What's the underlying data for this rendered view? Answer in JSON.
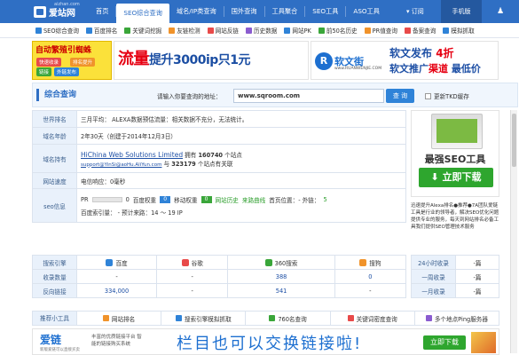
{
  "logo": {
    "text": "爱站网",
    "sub": "aizhan.com"
  },
  "nav": {
    "items": [
      "首页",
      "SEO综合查询",
      "域名/IP类查询",
      "国外查询",
      "工具聚合",
      "SEO工具",
      "ASO工具"
    ],
    "active": 1,
    "subscribe": "▾ 订阅",
    "mobile": "手机版",
    "user_icon": "user-icon"
  },
  "toolbar": {
    "items": [
      {
        "label": "SEO综合查询",
        "color": "#2f83d8"
      },
      {
        "label": "百度排名",
        "color": "#2f83d8"
      },
      {
        "label": "关键词挖掘",
        "color": "#3aa63a"
      },
      {
        "label": "友链检测",
        "color": "#f0932b"
      },
      {
        "label": "网站反链",
        "color": "#e84a4a"
      },
      {
        "label": "历史数据",
        "color": "#8a5cd0"
      },
      {
        "label": "网站PK",
        "color": "#2f83d8"
      },
      {
        "label": "前50名历史",
        "color": "#3aa63a"
      },
      {
        "label": "PR值查询",
        "color": "#f0932b"
      },
      {
        "label": "备案查询",
        "color": "#e84a4a"
      },
      {
        "label": "模拟抓取",
        "color": "#2f83d8"
      }
    ]
  },
  "ads": {
    "left": {
      "title": "自动繁殖引蜘蛛",
      "pills": [
        "快速收录",
        "排名提升",
        "链接",
        "外链发布"
      ]
    },
    "mid": {
      "big": "流量",
      "rest": "提升3000ip只1元"
    },
    "right": {
      "brand": "软文街",
      "url": "www.RUANWENJIE.COM",
      "line1_pre": "软文发布 ",
      "line1_hi": "4折",
      "line2_pre": "软文推广",
      "line2_hi": "渠道",
      "line2_post": " 最低价"
    }
  },
  "query": {
    "title": "综合查询",
    "label": "请输入你要查询的地址：",
    "value": "www.sqroom.com",
    "button": "查 询",
    "checkbox": "更新TKD缓存"
  },
  "info": {
    "rank": {
      "key": "世界排名",
      "value": "三月平均： ALEXA数据预估流量：相关数据不充分，无法统计。"
    },
    "age": {
      "key": "域名年龄",
      "value": "2年30天（创建于2014年12月3日）"
    },
    "owner": {
      "key": "域名持有",
      "name": "HiChina Web Solutions Limited",
      "mid1": " 拥有 ",
      "count1": "160740",
      "mid2": " 个站点",
      "email": "support@YinSi@aoHu.AliYun.com",
      "mid3": " 与 ",
      "count2": "323179",
      "mid4": " 个站点有关联"
    },
    "speed": {
      "key": "网站速度",
      "value": "电信响应：0毫秒"
    },
    "seo": {
      "key": "seo信息",
      "pr": "PR",
      "pr_val": "0",
      "baidu_w": "百度权重",
      "baidu_val": "0",
      "mobile_w": "移动权重",
      "mobile_val": "0",
      "history": "网站历史",
      "trend": "来路曲线",
      "home": "首页位置：- 外链：",
      "links": "5",
      "line2": "百度索引量： - 预计来路：14 ～ 19 IP"
    }
  },
  "side_ad": {
    "title": "最强SEO工具",
    "button": "立即下载",
    "desc": "迅速提升Alexa排名●推荐●7A团队爱链工具是行业的领导者，解决SEO优化问题提供专业的服务，每天到网站排名必备工具我们提供SEO管理技术服务"
  },
  "stats": {
    "headers": [
      "搜索引擎",
      "百度",
      "谷歌",
      "360搜索",
      "搜狗"
    ],
    "colors": [
      "#2f83d8",
      "#e84a4a",
      "#3aa63a",
      "#f0932b"
    ],
    "rows": [
      {
        "key": "收录数量",
        "values": [
          "-",
          "-",
          "388",
          "0"
        ]
      },
      {
        "key": "反向链接",
        "values": [
          "334,000",
          "-",
          "541",
          "-"
        ]
      }
    ]
  },
  "side24": {
    "rows": [
      [
        "24小时收录",
        "-篇"
      ],
      [
        "一周收录",
        "-篇"
      ],
      [
        "一月收录",
        "-篇"
      ]
    ]
  },
  "tools": {
    "key": "推荐小工具",
    "items": [
      {
        "label": "网站排名",
        "color": "#f0932b"
      },
      {
        "label": "搜索引擎模拟抓取",
        "color": "#2f83d8"
      },
      {
        "label": "760名查询",
        "color": "#3aa63a"
      },
      {
        "label": "关键词密度查询",
        "color": "#e84a4a"
      },
      {
        "label": "多个地点Ping服务器",
        "color": "#8a5cd0"
      }
    ]
  },
  "bottom": {
    "brand": "爱链",
    "brand_sub": "新版爱链可以直接买卖",
    "desc": "丰富的优质链接平台 智能的链接购买系统",
    "mid": "栏目也可以交换链接啦!",
    "button": "立即下载"
  }
}
